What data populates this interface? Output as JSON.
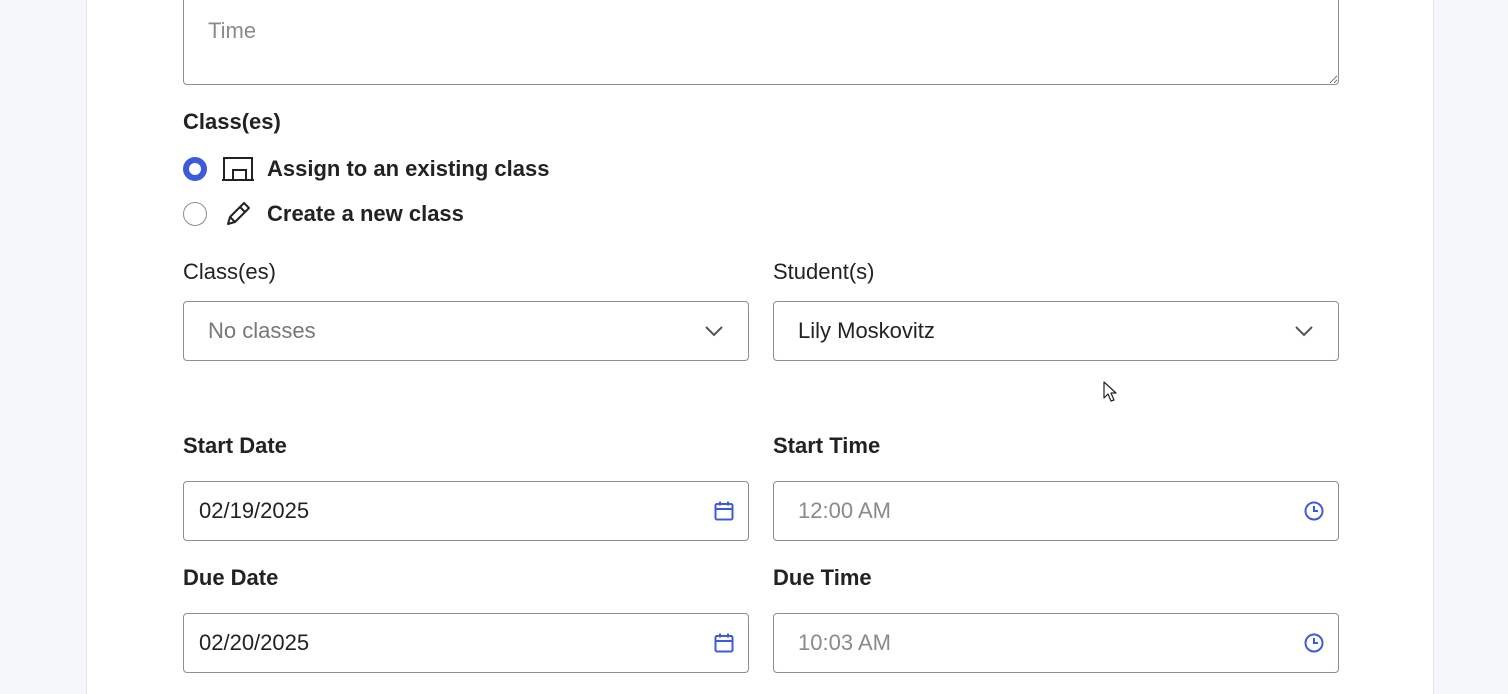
{
  "description_field": {
    "placeholder": "Time"
  },
  "classes_section": {
    "title": "Class(es)",
    "options": [
      {
        "label": "Assign to an existing class",
        "icon": "classroom-board-icon",
        "selected": true
      },
      {
        "label": "Create a new class",
        "icon": "pencil-icon",
        "selected": false
      }
    ]
  },
  "class_select": {
    "label": "Class(es)",
    "placeholder": "No classes"
  },
  "student_select": {
    "label": "Student(s)",
    "value": "Lily Moskovitz"
  },
  "start_date": {
    "label": "Start Date",
    "value": "02/19/2025"
  },
  "start_time": {
    "label": "Start Time",
    "placeholder": "12:00 AM"
  },
  "due_date": {
    "label": "Due Date",
    "value": "02/20/2025"
  },
  "due_time": {
    "label": "Due Time",
    "placeholder": "10:03 AM"
  },
  "colors": {
    "accent": "#3b5bdb",
    "border": "#8f8f8f",
    "page_background": "#f5f6fa"
  }
}
